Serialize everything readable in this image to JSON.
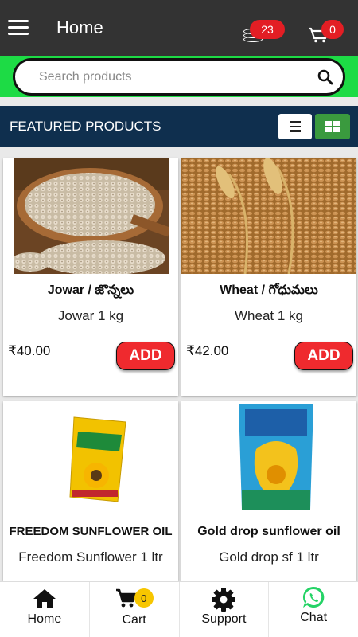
{
  "header": {
    "title": "Home",
    "wallet_count": "23",
    "cart_count": "0"
  },
  "search": {
    "placeholder": "Search products",
    "value": ""
  },
  "featured": {
    "title": "FEATURED PRODUCTS"
  },
  "products": [
    {
      "name": "Jowar / జొన్నలు",
      "description": "Jowar 1 kg",
      "price": "₹40.00",
      "button": "ADD"
    },
    {
      "name": "Wheat / గోధుమలు",
      "description": "Wheat 1 kg",
      "price": "₹42.00",
      "button": "ADD"
    },
    {
      "name": "FREEDOM SUNFLOWER OIL",
      "description": "Freedom Sunflower 1 ltr"
    },
    {
      "name": "Gold drop sunflower oil",
      "description": "Gold drop sf 1 ltr"
    }
  ],
  "bottom_nav": {
    "home": "Home",
    "cart": "Cart",
    "cart_count": "0",
    "support": "Support",
    "chat": "Chat"
  },
  "colors": {
    "app_bar": "#333333",
    "search_band": "#1ddb45",
    "featured_bar": "#0f2f4e",
    "add_button": "#ef2a2e",
    "badge": "#e31e24",
    "grid_toggle": "#3a9a3e",
    "cart_badge": "#f7c600"
  }
}
